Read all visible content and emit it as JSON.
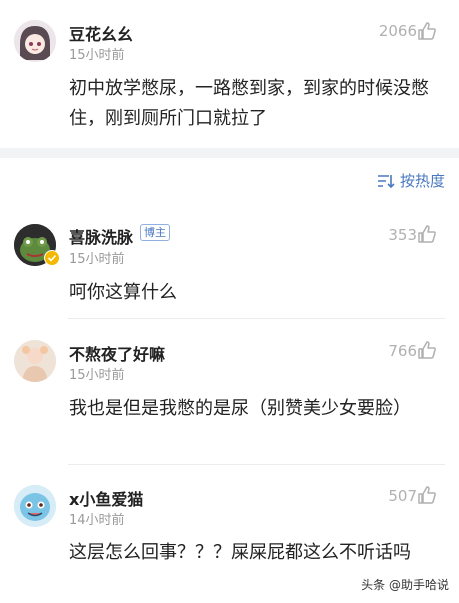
{
  "sort": {
    "label": "按热度"
  },
  "comments": [
    {
      "user": "豆花幺幺",
      "time": "15小时前",
      "likes": "2066",
      "text": "初中放学憋尿，一路憋到家，到家的时候没憋住，刚到厕所门口就拉了"
    },
    {
      "user": "喜脉洗脉",
      "badge": "博主",
      "time": "15小时前",
      "likes": "353",
      "text": "呵你这算什么"
    },
    {
      "user": "不熬夜了好嘛",
      "time": "15小时前",
      "likes": "766",
      "text": "我也是但是我憋的是尿（别赞美少女要脸）"
    },
    {
      "user": "x小鱼爱猫",
      "time": "14小时前",
      "likes": "507",
      "text": "这层怎么回事？？？屎屎屁都这么不听话吗"
    }
  ],
  "watermark": {
    "text": "头条 @助手哈说"
  },
  "icons": {
    "like": "thumbs-up-icon",
    "sort": "sort-lines-icon"
  }
}
